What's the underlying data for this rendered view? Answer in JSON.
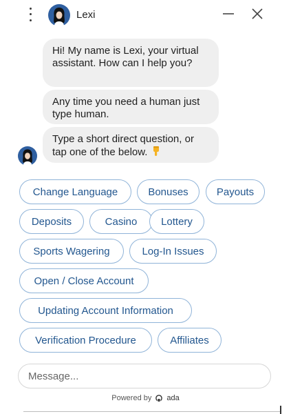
{
  "header": {
    "bot_name": "Lexi",
    "menu_icon": "kebab-menu-icon",
    "minimize_icon": "minimize-icon",
    "close_icon": "close-icon"
  },
  "messages": [
    {
      "text": "Hi! My name is Lexi, your virtual assistant. How can I help you?"
    },
    {
      "text": "Any time you need a human just type human."
    },
    {
      "text": "Type a short direct question, or tap one of the below.",
      "emoji_icon": "pointing-down-hand-icon"
    }
  ],
  "quick_replies": [
    "Change Language",
    "Bonuses",
    "Payouts",
    "Deposits",
    "Casino",
    "Lottery",
    "Sports Wagering",
    "Log-In Issues",
    "Open / Close Account",
    "Updating Account Information",
    "Verification Procedure",
    "Affiliates"
  ],
  "composer": {
    "placeholder": "Message..."
  },
  "footer": {
    "powered_by": "Powered by",
    "brand": "ada"
  },
  "colors": {
    "quick_reply_text": "#23578f",
    "quick_reply_border": "#8fb3d8",
    "bubble_bg": "#efefef"
  }
}
